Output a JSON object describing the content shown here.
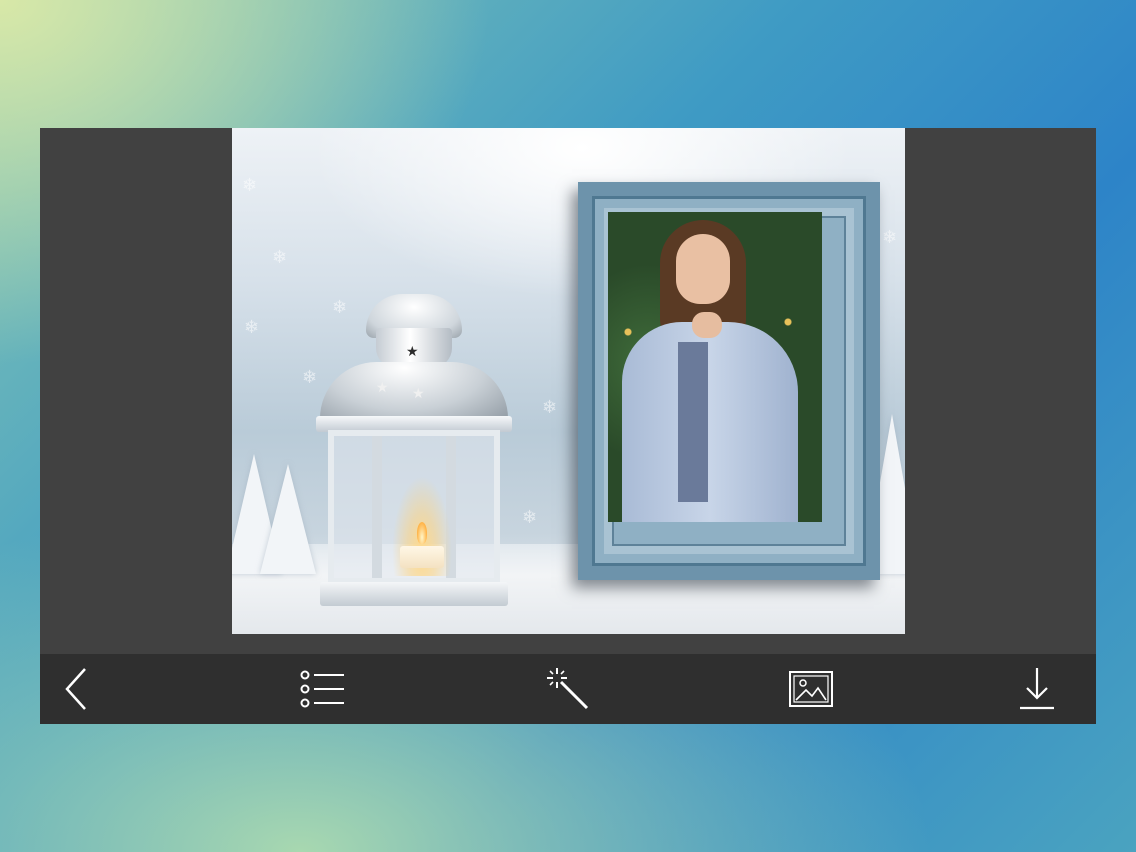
{
  "app": {
    "background_accent": "#2d84c8",
    "panel_color": "#414141",
    "toolbar_color": "#2f2f2f"
  },
  "canvas": {
    "scene": "winter lantern with framed portrait photo",
    "frame_color": "#6d93ab"
  },
  "toolbar": {
    "items": [
      {
        "name": "back",
        "icon": "chevron-left-icon"
      },
      {
        "name": "frames-list",
        "icon": "list-icon"
      },
      {
        "name": "effects",
        "icon": "magic-wand-icon"
      },
      {
        "name": "gallery",
        "icon": "image-icon"
      },
      {
        "name": "download",
        "icon": "download-icon"
      }
    ]
  }
}
